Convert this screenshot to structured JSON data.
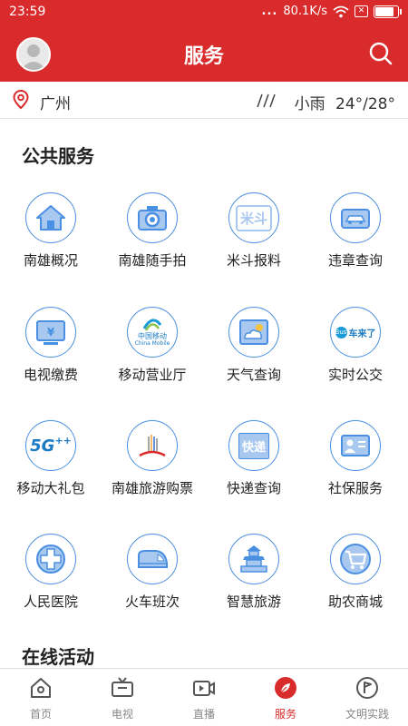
{
  "status_bar": {
    "time": "23:59",
    "dots": "...",
    "network_speed": "80.1K/s",
    "sim_mark": "✕"
  },
  "header": {
    "title": "服务"
  },
  "location": {
    "city": "广州",
    "weather": "小雨",
    "temperature": "24°/28°"
  },
  "sections": {
    "public_services": "公共服务",
    "online_activities": "在线活动"
  },
  "services": [
    {
      "label": "南雄概况",
      "icon": "house-icon"
    },
    {
      "label": "南雄随手拍",
      "icon": "camera-icon"
    },
    {
      "label": "米斗报料",
      "icon": "mi-dou-logo-icon",
      "icon_text": "米斗"
    },
    {
      "label": "违章查询",
      "icon": "car-icon"
    },
    {
      "label": "电视缴费",
      "icon": "tv-yuan-icon",
      "icon_text": "¥"
    },
    {
      "label": "移动营业厅",
      "icon": "china-mobile-logo-icon",
      "icon_text": "中国移动",
      "icon_subtext": "China Mobile"
    },
    {
      "label": "天气查询",
      "icon": "cloud-sun-icon"
    },
    {
      "label": "实时公交",
      "icon": "bus-logo-icon",
      "icon_text": "车来了",
      "icon_badge": "Bus"
    },
    {
      "label": "移动大礼包",
      "icon": "5g-logo-icon",
      "icon_text": "5G",
      "icon_plus": "++"
    },
    {
      "label": "南雄旅游购票",
      "icon": "ticket-icon"
    },
    {
      "label": "快递查询",
      "icon": "express-icon",
      "icon_text": "快递"
    },
    {
      "label": "社保服务",
      "icon": "id-card-icon"
    },
    {
      "label": "人民医院",
      "icon": "medical-cross-icon"
    },
    {
      "label": "火车班次",
      "icon": "train-icon"
    },
    {
      "label": "智慧旅游",
      "icon": "pagoda-icon"
    },
    {
      "label": "助农商城",
      "icon": "shopping-cart-icon"
    }
  ],
  "tabs": [
    {
      "label": "首页",
      "icon": "home-icon",
      "active": false
    },
    {
      "label": "电视",
      "icon": "tv-icon",
      "active": false
    },
    {
      "label": "直播",
      "icon": "live-video-icon",
      "active": false
    },
    {
      "label": "服务",
      "icon": "service-leaf-icon",
      "active": true
    },
    {
      "label": "文明实践",
      "icon": "civilization-flag-icon",
      "active": false
    }
  ],
  "colors": {
    "brand_red": "#d92b2b",
    "icon_blue": "#4a90e2",
    "icon_fill": "#a8c8f0"
  }
}
